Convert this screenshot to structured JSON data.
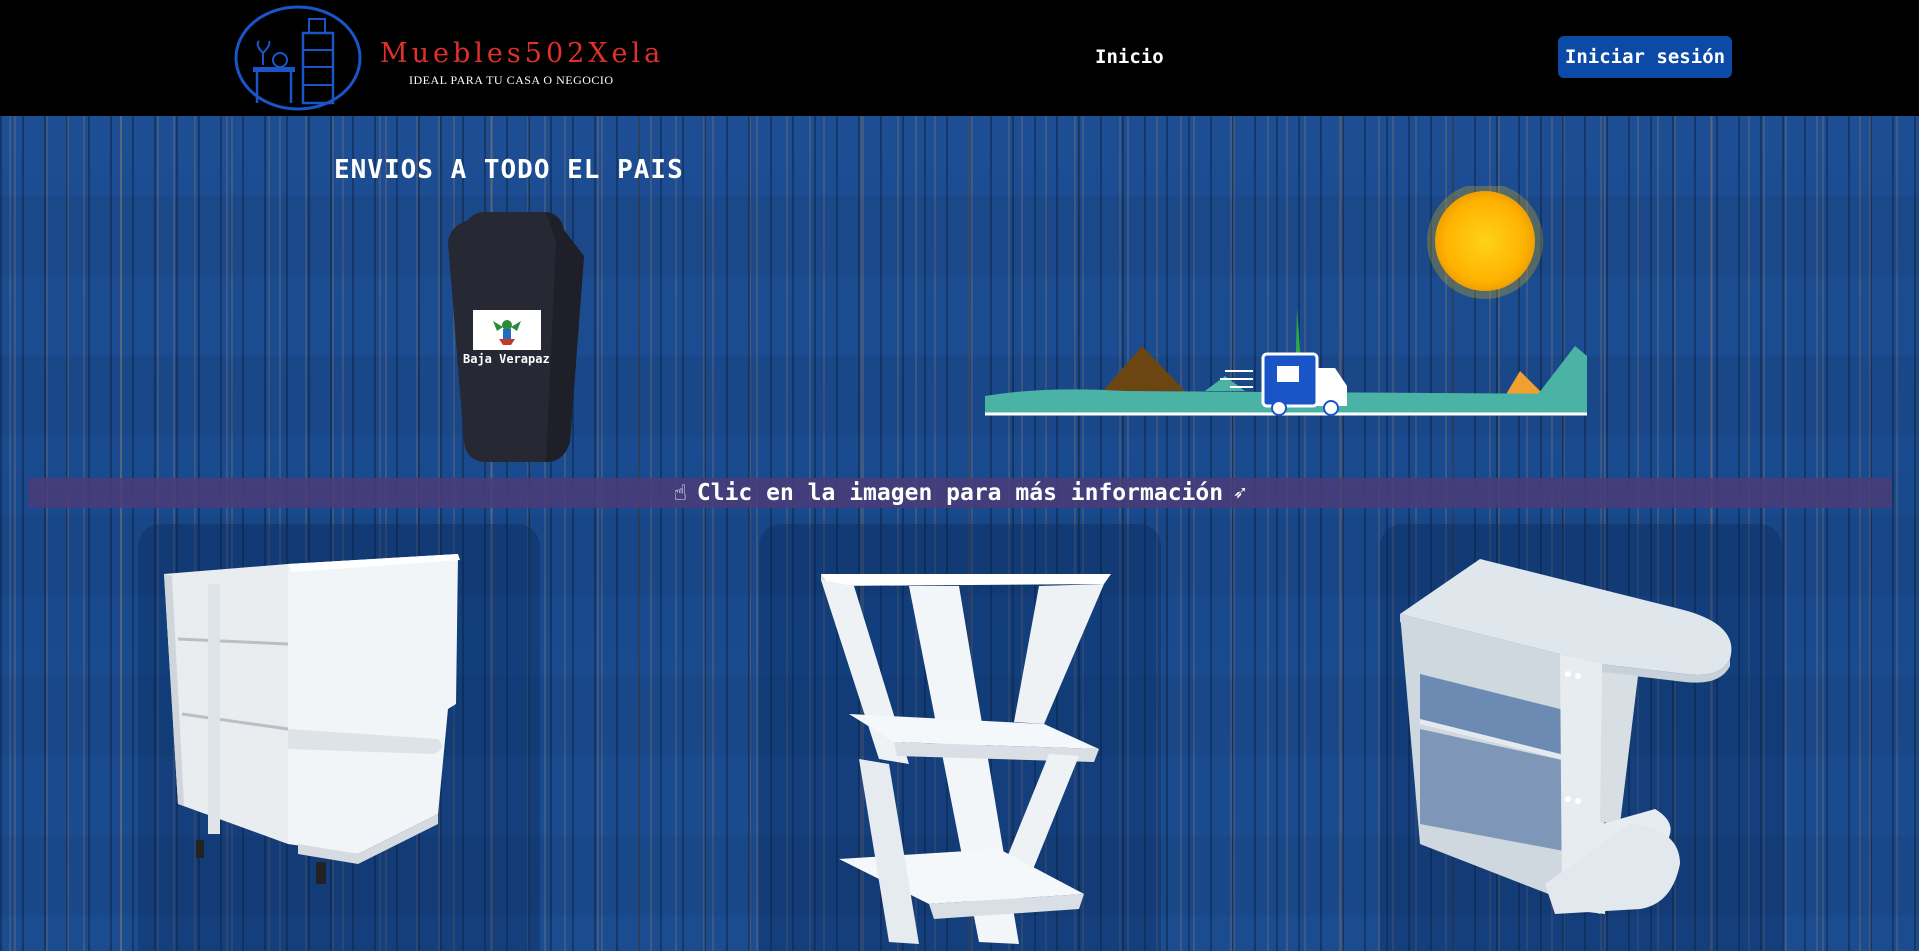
{
  "header": {
    "brand_name": "Muebles502Xela",
    "brand_tagline": "IDEAL PARA TU CASA O NEGOCIO",
    "nav_inicio": "Inicio",
    "login_label": "Iniciar sesión",
    "brand_color": "#e0302a",
    "accent_color": "#0c4aa8"
  },
  "hero": {
    "title": "ENVIOS A TODO EL PAIS",
    "phone_label": "Baja Verapaz",
    "truck_icon": "delivery-truck-icon",
    "sun_icon": "sun-icon"
  },
  "info_bar": {
    "text": "Clic en la imagen para más información",
    "left_icon": "pointing-hand-icon",
    "right_icon": "click-cursor-icon"
  },
  "products": [
    {
      "name": "corner-shelf"
    },
    {
      "name": "zigzag-shelf"
    },
    {
      "name": "round-end-shelf"
    }
  ]
}
